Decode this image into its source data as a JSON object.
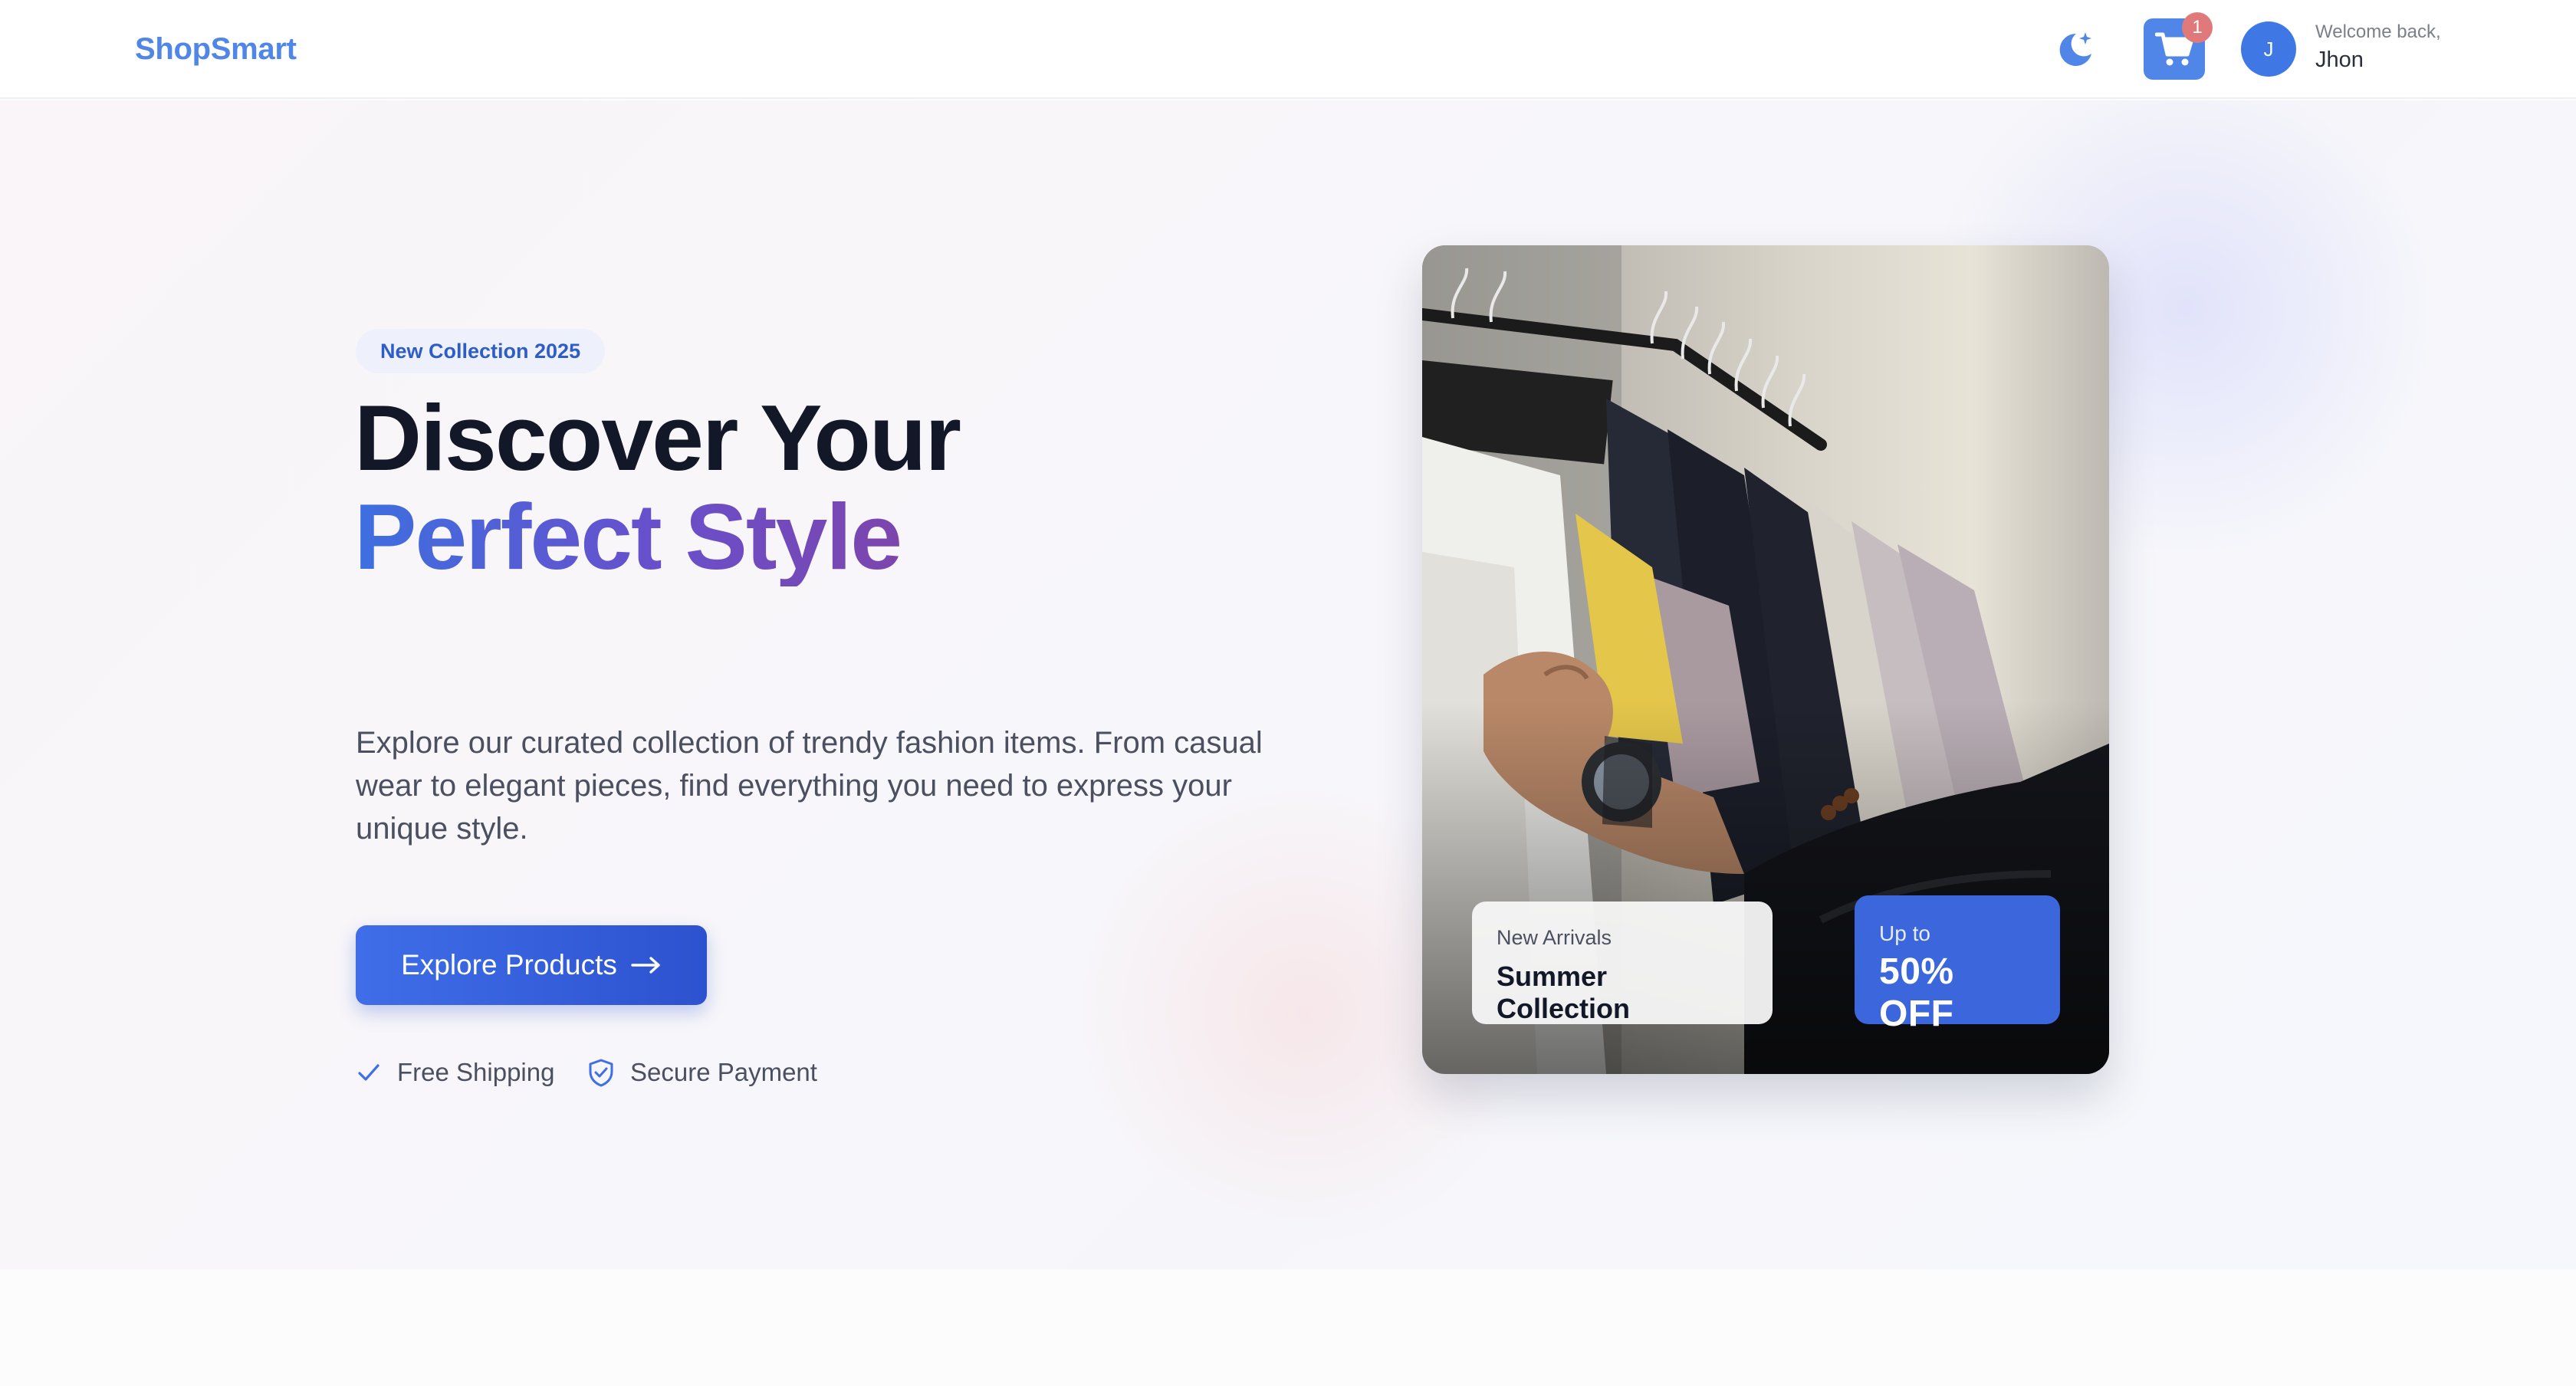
{
  "header": {
    "logo": "ShopSmart",
    "theme_toggle_icon": "moon-sparkle-icon",
    "cart": {
      "icon": "cart-icon",
      "count": "1"
    },
    "user": {
      "avatar_initial": "J",
      "greeting": "Welcome back,",
      "name": "Jhon"
    }
  },
  "hero": {
    "tag": "New Collection 2025",
    "headline_line1": "Discover Your",
    "headline_line2": "Perfect Style",
    "description": "Explore our curated collection of trendy fashion items. From casual wear to elegant pieces, find everything you need to express your unique style.",
    "cta_label": "Explore Products",
    "cta_icon": "arrow-right-icon",
    "features": [
      {
        "label": "Free Shipping",
        "icon": "check-icon"
      },
      {
        "label": "Secure Payment",
        "icon": "shield-check-icon"
      }
    ]
  },
  "promo": {
    "image_subject": "clothes-rack-photo",
    "arrivals": {
      "label": "New Arrivals",
      "title": "Summer Collection"
    },
    "discount": {
      "label": "Up to",
      "value": "50% OFF"
    }
  },
  "colors": {
    "brand": "#4f86e8",
    "accent_blue": "#3b66dc",
    "badge_red": "#e07a7a",
    "headline_dark": "#121828",
    "gradient_start": "#3d6fe0",
    "gradient_end": "#7d45ad"
  }
}
